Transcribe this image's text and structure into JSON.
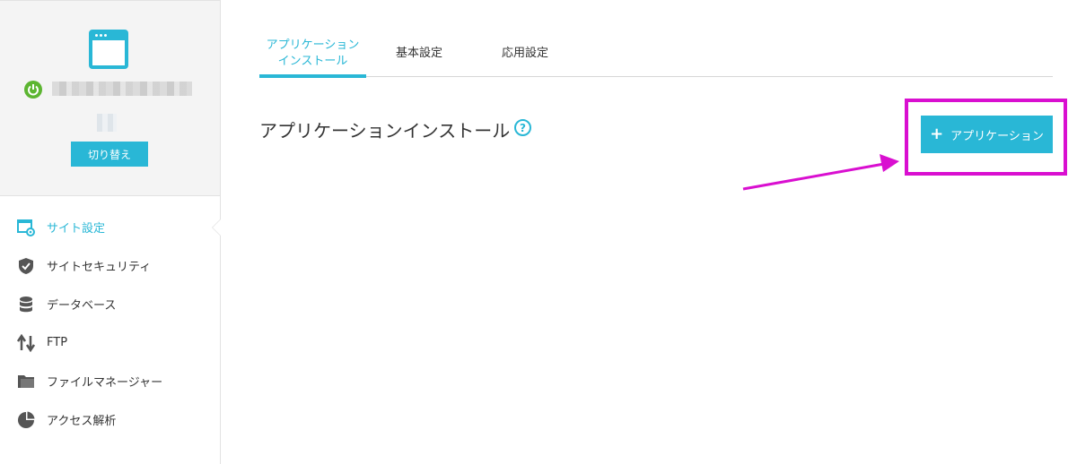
{
  "sidebar": {
    "site": {
      "switch_label": "切り替え"
    },
    "items": [
      {
        "label": "サイト設定",
        "icon": "site-settings-icon",
        "active": true
      },
      {
        "label": "サイトセキュリティ",
        "icon": "shield-check-icon",
        "active": false
      },
      {
        "label": "データベース",
        "icon": "database-icon",
        "active": false
      },
      {
        "label": "FTP",
        "icon": "transfer-arrows-icon",
        "active": false
      },
      {
        "label": "ファイルマネージャー",
        "icon": "folder-icon",
        "active": false
      },
      {
        "label": "アクセス解析",
        "icon": "pie-chart-icon",
        "active": false
      }
    ]
  },
  "tabs": [
    {
      "label_line1": "アプリケーション",
      "label_line2": "インストール",
      "active": true
    },
    {
      "label": "基本設定",
      "active": false
    },
    {
      "label": "応用設定",
      "active": false
    }
  ],
  "main": {
    "title": "アプリケーションインストール",
    "help_symbol": "?",
    "add_button_label": "アプリケーション",
    "add_button_symbol": "+"
  },
  "colors": {
    "accent": "#29b7d6",
    "highlight": "#d90fd0",
    "status_on": "#5cb531"
  }
}
